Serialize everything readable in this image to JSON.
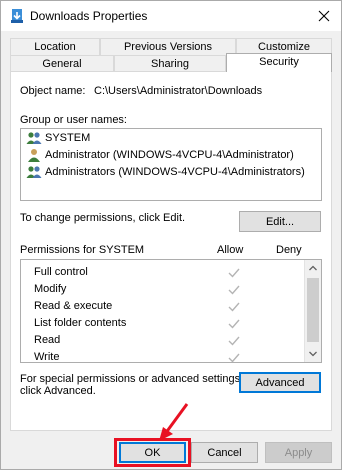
{
  "window": {
    "title": "Downloads Properties",
    "close_icon": "close-icon",
    "folder_icon": "folder-download-icon"
  },
  "tabs": {
    "row1": [
      "Location",
      "Previous Versions",
      "Customize"
    ],
    "row2": [
      "General",
      "Sharing",
      "Security"
    ],
    "active": "Security"
  },
  "object": {
    "label": "Object name:",
    "value": "C:\\Users\\Administrator\\Downloads"
  },
  "groups": {
    "label": "Group or user names:",
    "items": [
      {
        "name": "SYSTEM",
        "icon": "users-group-icon",
        "selected": true
      },
      {
        "name": "Administrator (WINDOWS-4VCPU-4\\Administrator)",
        "icon": "user-icon",
        "selected": false
      },
      {
        "name": "Administrators (WINDOWS-4VCPU-4\\Administrators)",
        "icon": "users-group-icon",
        "selected": false
      }
    ]
  },
  "change": {
    "text": "To change permissions, click Edit.",
    "edit_label": "Edit..."
  },
  "permissions": {
    "header": "Permissions for SYSTEM",
    "allow_header": "Allow",
    "deny_header": "Deny",
    "rows": [
      {
        "name": "Full control",
        "allow": true,
        "deny": false
      },
      {
        "name": "Modify",
        "allow": true,
        "deny": false
      },
      {
        "name": "Read & execute",
        "allow": true,
        "deny": false
      },
      {
        "name": "List folder contents",
        "allow": true,
        "deny": false
      },
      {
        "name": "Read",
        "allow": true,
        "deny": false
      },
      {
        "name": "Write",
        "allow": true,
        "deny": false
      }
    ]
  },
  "special": {
    "line1": "For special permissions or advanced settings,",
    "line2": "click Advanced.",
    "advanced_label": "Advanced"
  },
  "footer": {
    "ok_label": "OK",
    "cancel_label": "Cancel",
    "apply_label": "Apply"
  },
  "colors": {
    "annotation": "#e81123",
    "focus": "#0078d7",
    "check": "#b4b4b4"
  }
}
